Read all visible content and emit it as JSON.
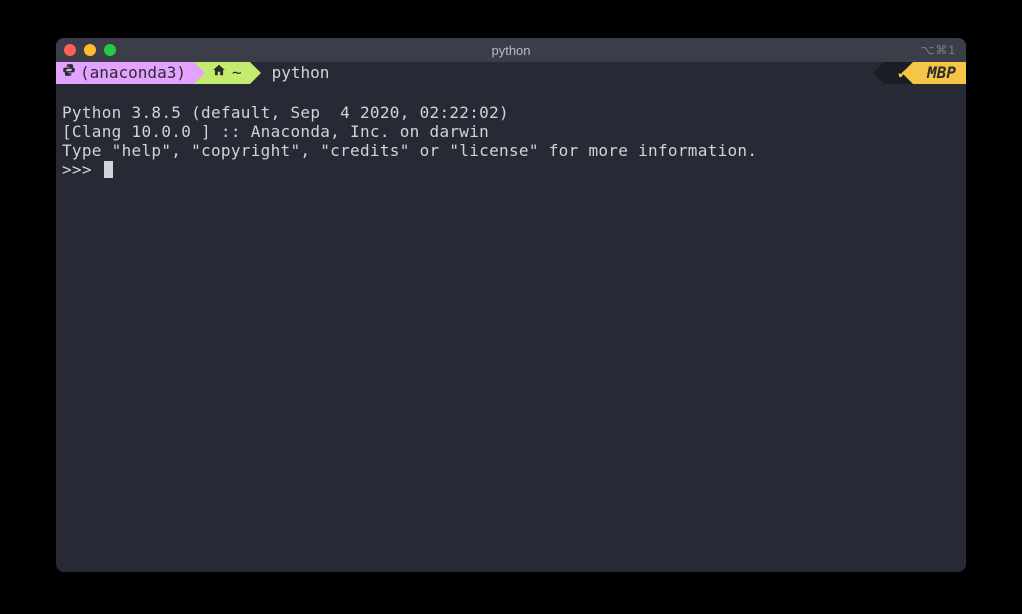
{
  "window": {
    "title": "python",
    "shortcut_hint": "⌥⌘1"
  },
  "prompt": {
    "env_segment": "(anaconda3)",
    "dir_segment": "~",
    "snake_glyph": "⏀",
    "home_glyph": "⌂",
    "command": "python",
    "status_check": "✔",
    "host": "MBP"
  },
  "output": {
    "line1": "Python 3.8.5 (default, Sep  4 2020, 02:22:02)",
    "line2": "[Clang 10.0.0 ] :: Anaconda, Inc. on darwin",
    "line3": "Type \"help\", \"copyright\", \"credits\" or \"license\" for more information."
  },
  "repl": {
    "prompt": ">>> "
  }
}
